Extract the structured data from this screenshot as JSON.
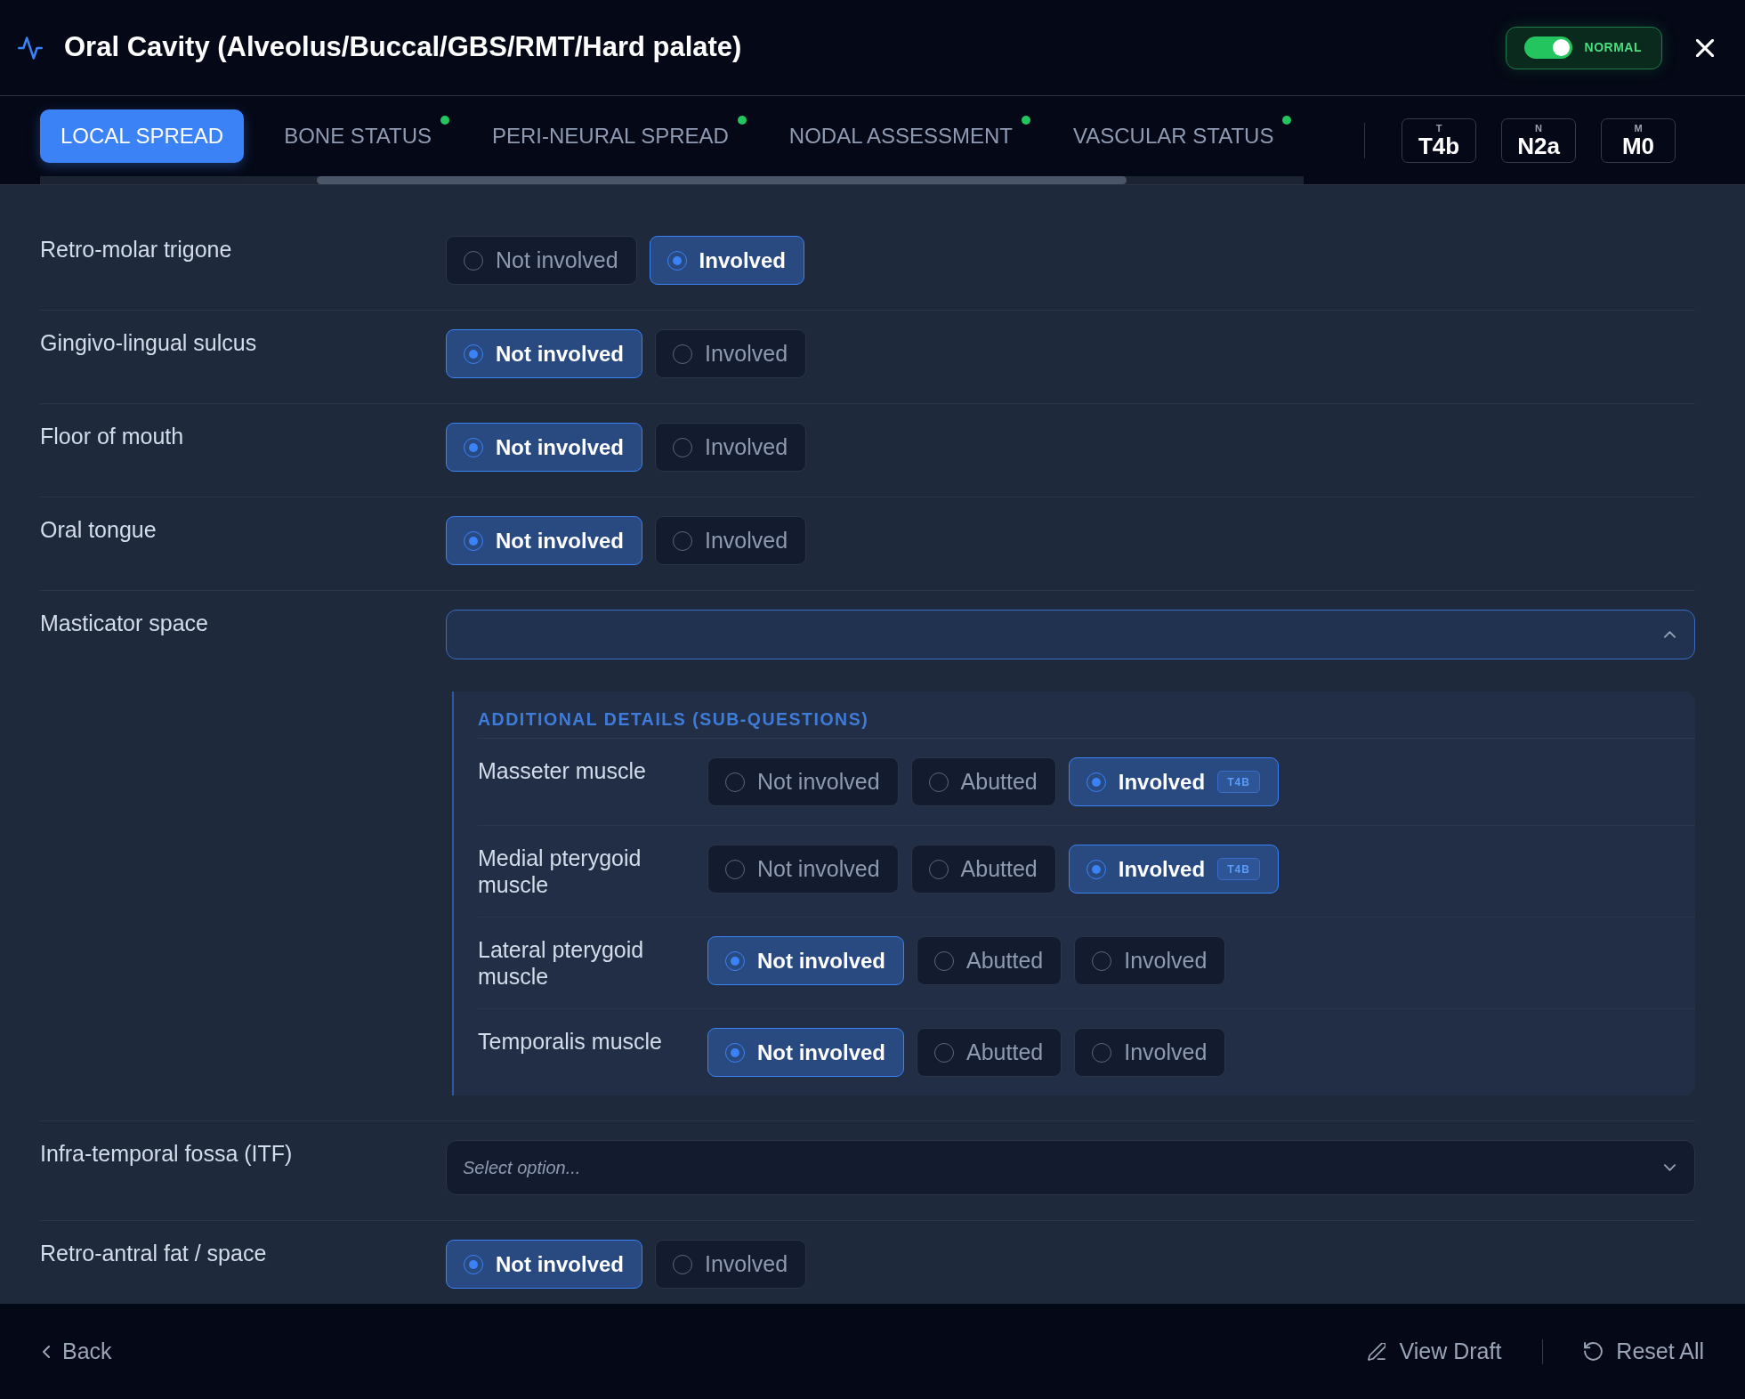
{
  "header": {
    "title": "Oral Cavity (Alveolus/Buccal/GBS/RMT/Hard palate)",
    "mode_toggle": {
      "label": "NORMAL",
      "on": true
    }
  },
  "tabs": [
    {
      "label": "LOCAL SPREAD",
      "selected": true,
      "complete": false
    },
    {
      "label": "BONE STATUS",
      "selected": false,
      "complete": true
    },
    {
      "label": "PERI-NEURAL SPREAD",
      "selected": false,
      "complete": true
    },
    {
      "label": "NODAL ASSESSMENT",
      "selected": false,
      "complete": true
    },
    {
      "label": "VASCULAR STATUS",
      "selected": false,
      "complete": true
    }
  ],
  "staging": [
    {
      "letter": "T",
      "value": "T4b"
    },
    {
      "letter": "N",
      "value": "N2a"
    },
    {
      "letter": "M",
      "value": "M0"
    }
  ],
  "questions": [
    {
      "kind": "radio",
      "label": "Retro-molar trigone",
      "options": [
        {
          "label": "Not involved",
          "selected": false
        },
        {
          "label": "Involved",
          "selected": true
        }
      ]
    },
    {
      "kind": "radio",
      "label": "Gingivo-lingual sulcus",
      "options": [
        {
          "label": "Not involved",
          "selected": true
        },
        {
          "label": "Involved",
          "selected": false
        }
      ]
    },
    {
      "kind": "radio",
      "label": "Floor of mouth",
      "options": [
        {
          "label": "Not involved",
          "selected": true
        },
        {
          "label": "Involved",
          "selected": false
        }
      ]
    },
    {
      "kind": "radio",
      "label": "Oral tongue",
      "options": [
        {
          "label": "Not involved",
          "selected": true
        },
        {
          "label": "Involved",
          "selected": false
        }
      ]
    },
    {
      "kind": "dropdown",
      "label": "Masticator space",
      "expanded": true,
      "sub_questions": {
        "heading": "ADDITIONAL DETAILS (SUB-QUESTIONS)",
        "items": [
          {
            "label": "Masseter muscle",
            "options": [
              {
                "label": "Not involved",
                "selected": false
              },
              {
                "label": "Abutted",
                "selected": false
              },
              {
                "label": "Involved",
                "selected": true,
                "badge": "T4B"
              }
            ]
          },
          {
            "label": "Medial pterygoid muscle",
            "options": [
              {
                "label": "Not involved",
                "selected": false
              },
              {
                "label": "Abutted",
                "selected": false
              },
              {
                "label": "Involved",
                "selected": true,
                "badge": "T4B"
              }
            ]
          },
          {
            "label": "Lateral pterygoid muscle",
            "options": [
              {
                "label": "Not involved",
                "selected": true
              },
              {
                "label": "Abutted",
                "selected": false
              },
              {
                "label": "Involved",
                "selected": false
              }
            ]
          },
          {
            "label": "Temporalis muscle",
            "options": [
              {
                "label": "Not involved",
                "selected": true
              },
              {
                "label": "Abutted",
                "selected": false
              },
              {
                "label": "Involved",
                "selected": false
              }
            ]
          }
        ]
      }
    },
    {
      "kind": "dropdown",
      "label": "Infra-temporal fossa (ITF)",
      "expanded": false,
      "placeholder": "Select option..."
    },
    {
      "kind": "radio",
      "label": "Retro-antral fat / space",
      "options": [
        {
          "label": "Not involved",
          "selected": true
        },
        {
          "label": "Involved",
          "selected": false
        }
      ]
    }
  ],
  "footer": {
    "back": "Back",
    "view_draft": "View Draft",
    "reset": "Reset All"
  }
}
